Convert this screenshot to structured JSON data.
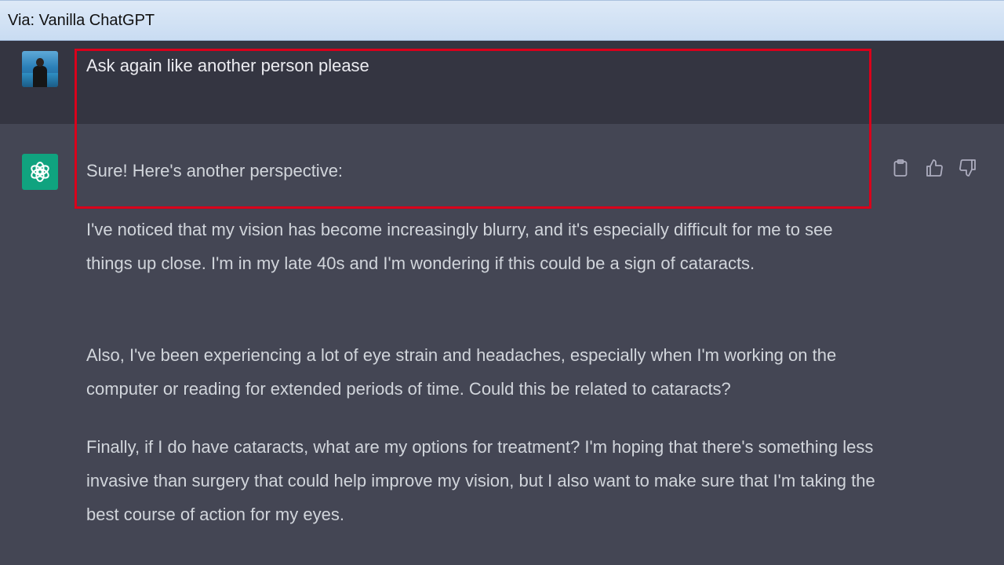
{
  "window": {
    "title": "Via: Vanilla ChatGPT"
  },
  "conversation": {
    "user_message": {
      "text": "Ask again like another person please",
      "avatar_icon": "user-photo-avatar"
    },
    "assistant_message": {
      "avatar_icon": "openai-logo-icon",
      "avatar_color": "#10a37f",
      "intro": "Sure! Here's another perspective:",
      "paragraphs": [
        "I've noticed that my vision has become increasingly blurry, and it's especially difficult for me to see things up close. I'm in my late 40s and I'm wondering if this could be a sign of cataracts.",
        "Also, I've been experiencing a lot of eye strain and headaches, especially when I'm working on the computer or reading for extended periods of time. Could this be related to cataracts?",
        "Finally, if I do have cataracts, what are my options for treatment? I'm hoping that there's something less invasive than surgery that could help improve my vision, but I also want to make sure that I'm taking the best course of action for my eyes."
      ],
      "actions": [
        {
          "name": "copy",
          "icon": "clipboard-icon"
        },
        {
          "name": "thumbs-up",
          "icon": "thumbs-up-icon"
        },
        {
          "name": "thumbs-down",
          "icon": "thumbs-down-icon"
        }
      ]
    }
  },
  "annotation": {
    "highlight_color": "#d9001b"
  },
  "colors": {
    "user_row_bg": "#343541",
    "assistant_row_bg": "#444654",
    "text_primary": "#ececf1",
    "text_secondary": "#d1d5db"
  }
}
